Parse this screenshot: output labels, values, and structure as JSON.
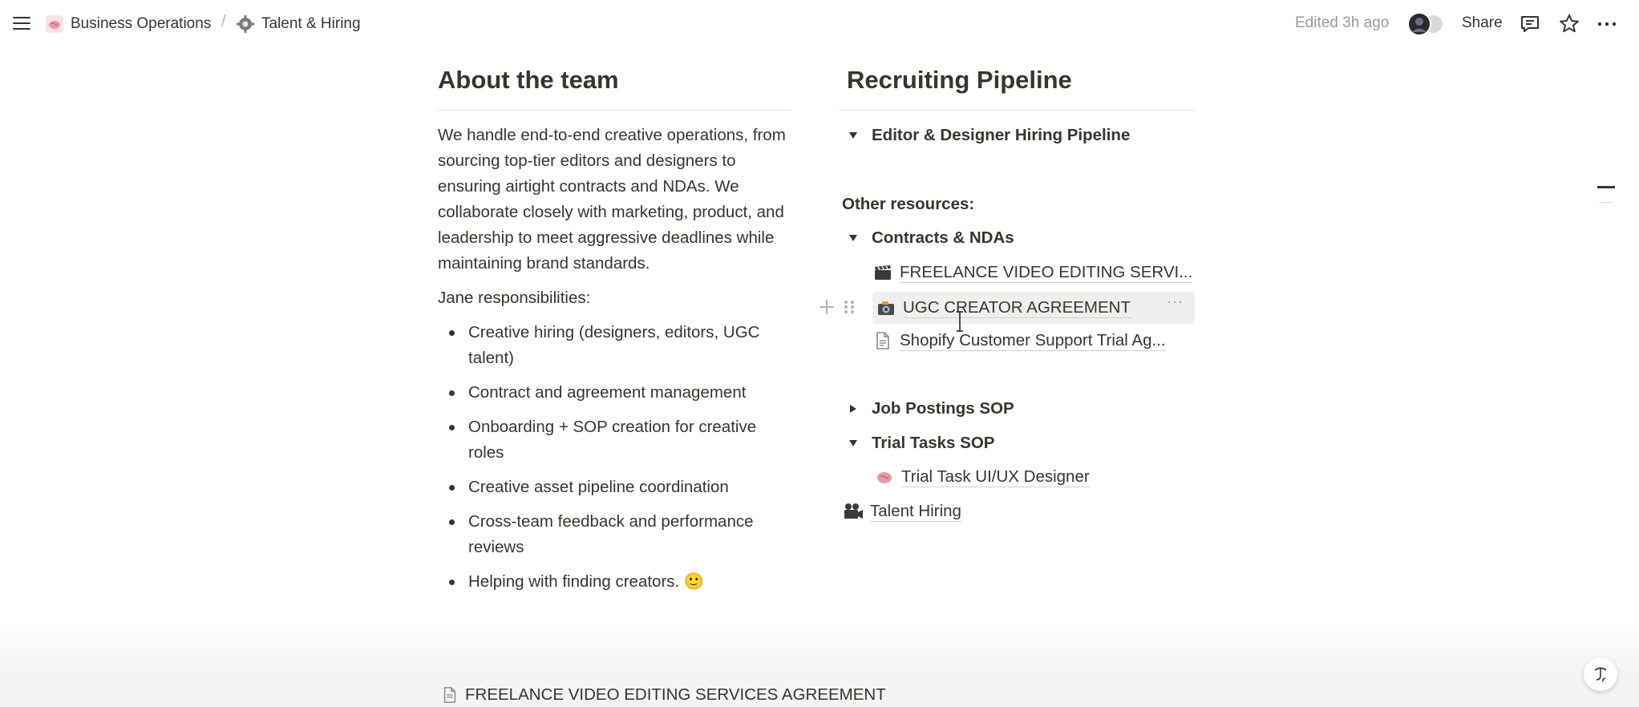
{
  "topbar": {
    "breadcrumbs": [
      {
        "label": "Business Operations",
        "icon": "brain-emoji-icon"
      },
      {
        "label": "Talent & Hiring",
        "icon": "gear-emoji-icon"
      }
    ],
    "separator": "/",
    "edited": "Edited 3h ago",
    "share_label": "Share"
  },
  "about": {
    "title": "About the team",
    "description": "We handle end-to-end creative operations, from sourcing top-tier editors and designers to ensuring airtight contracts and NDAs. We collaborate closely with marketing, product, and leadership to meet aggressive deadlines while maintaining brand standards.",
    "responsibilities_heading": "Jane responsibilities:",
    "responsibilities": [
      "Creative hiring (designers, editors, UGC talent)",
      "Contract and agreement management",
      "Onboarding + SOP creation for creative roles",
      "Creative asset pipeline coordination",
      "Cross-team feedback and performance reviews",
      "Helping with finding creators. 🙂"
    ]
  },
  "pipeline": {
    "title": "Recruiting Pipeline",
    "editor_toggle": "Editor & Designer Hiring Pipeline",
    "other_resources": "Other resources:",
    "contracts_toggle": "Contracts & NDAs",
    "contracts_pages": [
      {
        "label": "FREELANCE VIDEO EDITING SERVI...",
        "icon": "clapper-icon"
      },
      {
        "label": "UGC CREATOR AGREEMENT",
        "icon": "camera-icon"
      },
      {
        "label": "Shopify Customer Support Trial Ag...",
        "icon": "page-icon"
      }
    ],
    "job_postings_toggle": "Job Postings SOP",
    "trial_tasks_toggle": "Trial Tasks SOP",
    "trial_task_page": "Trial Task UI/UX Designer",
    "talent_hiring_page": "Talent Hiring"
  },
  "footer": {
    "peek_page": "FREELANCE VIDEO EDITING SERVICES AGREEMENT"
  },
  "colors": {
    "text": "#37352f",
    "muted": "#9b9a97",
    "hover_bg": "#efefed"
  }
}
